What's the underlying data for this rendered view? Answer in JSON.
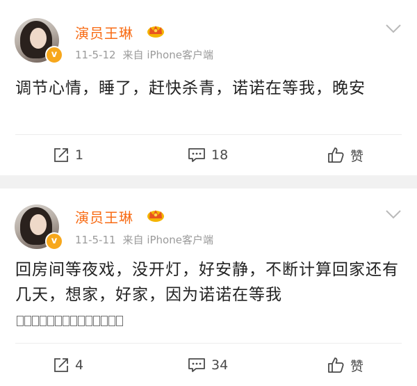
{
  "posts": [
    {
      "author": "演员王琳",
      "date": "11-5-12",
      "source": "来自 iPhone客户端",
      "text": "调节心情，睡了，赶快杀青，诺诺在等我，晚安",
      "reposts": "1",
      "comments": "18",
      "like_label": "赞",
      "verified_badge": "v"
    },
    {
      "author": "演员王琳",
      "date": "11-5-11",
      "source": "来自 iPhone客户端",
      "text": "回房间等夜戏，没开灯，好安静，不断计算回家还有几天，想家，好家，因为诺诺在等我",
      "reposts": "4",
      "comments": "34",
      "like_label": "赞",
      "verified_badge": "v"
    }
  ],
  "colors": {
    "author": "#f86b14",
    "badge": "#f7a71c",
    "meta": "#9a9a9a",
    "background": "#f1f1f1"
  },
  "icons": [
    "crown-icon",
    "chevron-down-icon",
    "repost-icon",
    "comment-icon",
    "like-icon",
    "verified-badge-icon"
  ]
}
